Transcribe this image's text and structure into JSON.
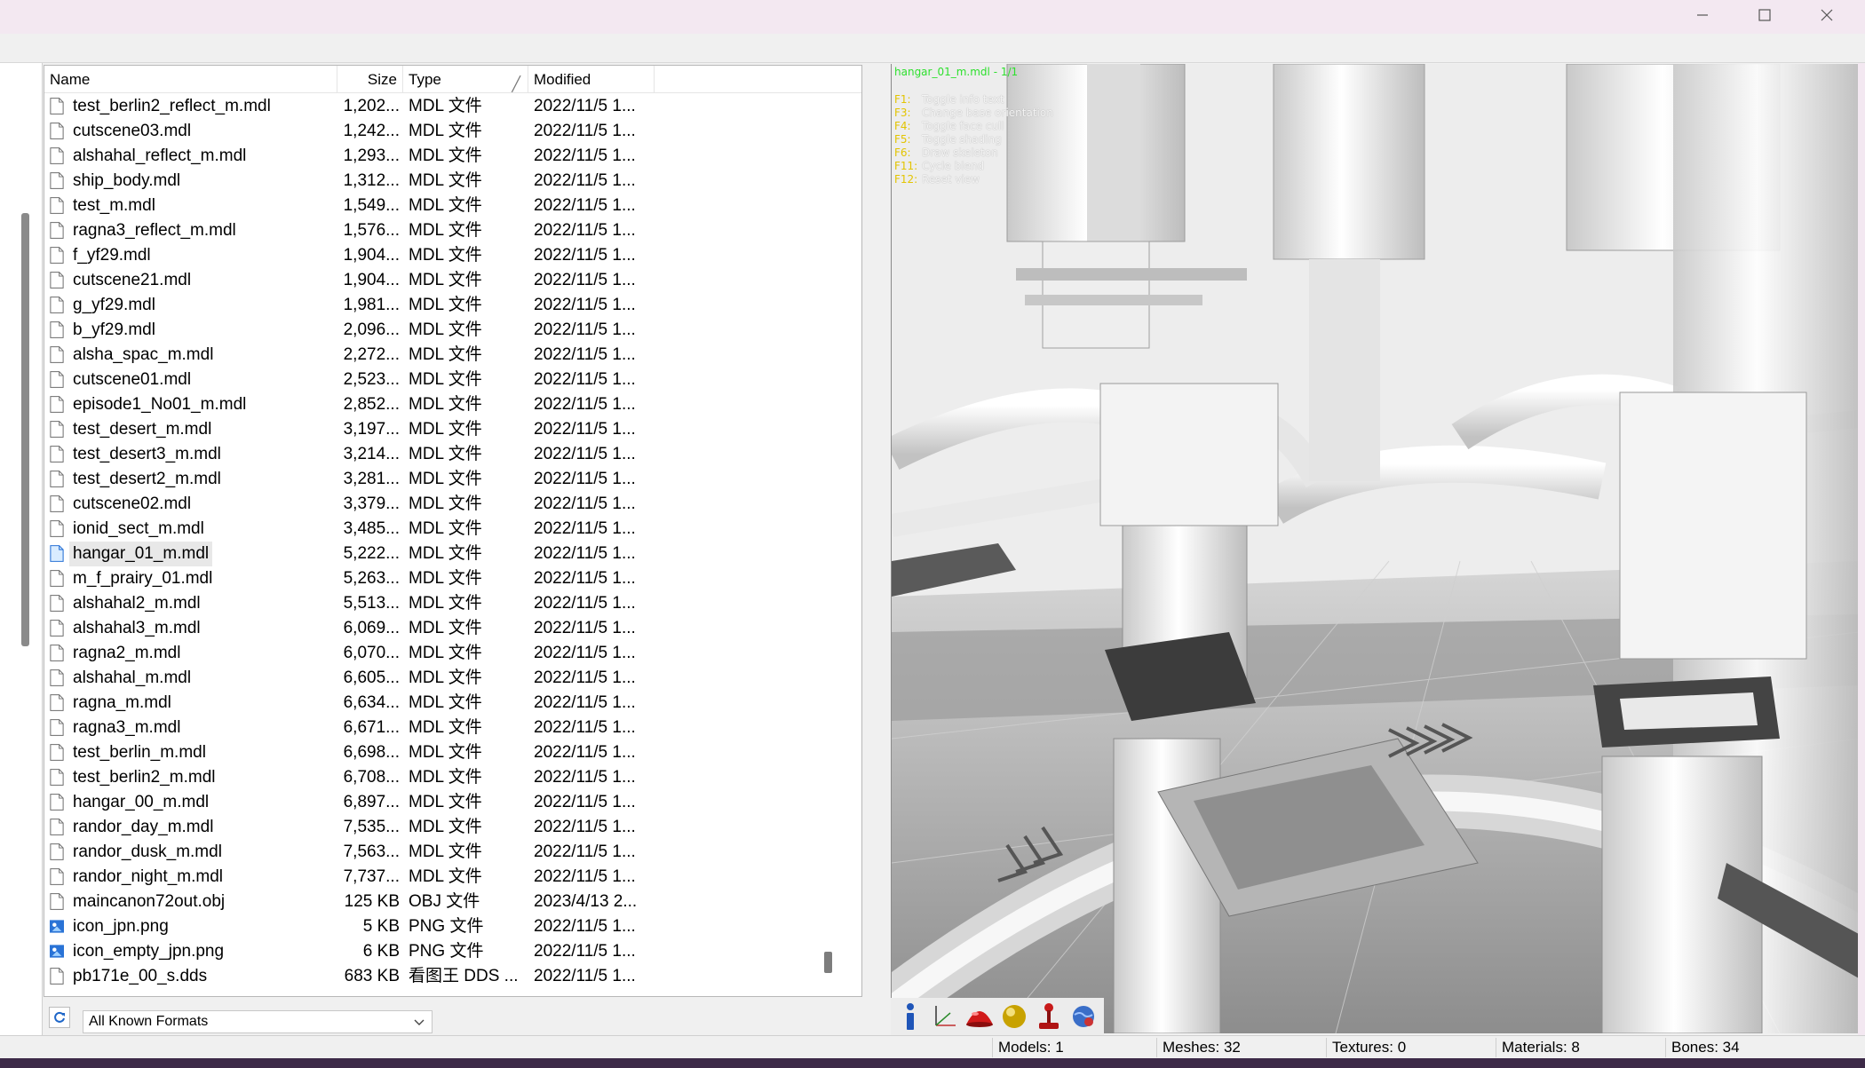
{
  "window": {
    "controls": [
      "minimize-icon",
      "maximize-icon",
      "close-icon"
    ]
  },
  "file_list": {
    "columns": {
      "name": "Name",
      "size": "Size",
      "type": "Type",
      "modified": "Modified"
    },
    "selected_index": 18,
    "files": [
      {
        "name": "test_berlin2_reflect_m.mdl",
        "size": "1,202...",
        "type": "MDL 文件",
        "modified": "2022/11/5 1...",
        "icon": "file-icon"
      },
      {
        "name": "cutscene03.mdl",
        "size": "1,242...",
        "type": "MDL 文件",
        "modified": "2022/11/5 1...",
        "icon": "file-icon"
      },
      {
        "name": "alshahal_reflect_m.mdl",
        "size": "1,293...",
        "type": "MDL 文件",
        "modified": "2022/11/5 1...",
        "icon": "file-icon"
      },
      {
        "name": "ship_body.mdl",
        "size": "1,312...",
        "type": "MDL 文件",
        "modified": "2022/11/5 1...",
        "icon": "file-icon"
      },
      {
        "name": "test_m.mdl",
        "size": "1,549...",
        "type": "MDL 文件",
        "modified": "2022/11/5 1...",
        "icon": "file-icon"
      },
      {
        "name": "ragna3_reflect_m.mdl",
        "size": "1,576...",
        "type": "MDL 文件",
        "modified": "2022/11/5 1...",
        "icon": "file-icon"
      },
      {
        "name": "f_yf29.mdl",
        "size": "1,904...",
        "type": "MDL 文件",
        "modified": "2022/11/5 1...",
        "icon": "file-icon"
      },
      {
        "name": "cutscene21.mdl",
        "size": "1,904...",
        "type": "MDL 文件",
        "modified": "2022/11/5 1...",
        "icon": "file-icon"
      },
      {
        "name": "g_yf29.mdl",
        "size": "1,981...",
        "type": "MDL 文件",
        "modified": "2022/11/5 1...",
        "icon": "file-icon"
      },
      {
        "name": "b_yf29.mdl",
        "size": "2,096...",
        "type": "MDL 文件",
        "modified": "2022/11/5 1...",
        "icon": "file-icon"
      },
      {
        "name": "alsha_spac_m.mdl",
        "size": "2,272...",
        "type": "MDL 文件",
        "modified": "2022/11/5 1...",
        "icon": "file-icon"
      },
      {
        "name": "cutscene01.mdl",
        "size": "2,523...",
        "type": "MDL 文件",
        "modified": "2022/11/5 1...",
        "icon": "file-icon"
      },
      {
        "name": "episode1_No01_m.mdl",
        "size": "2,852...",
        "type": "MDL 文件",
        "modified": "2022/11/5 1...",
        "icon": "file-icon"
      },
      {
        "name": "test_desert_m.mdl",
        "size": "3,197...",
        "type": "MDL 文件",
        "modified": "2022/11/5 1...",
        "icon": "file-icon"
      },
      {
        "name": "test_desert3_m.mdl",
        "size": "3,214...",
        "type": "MDL 文件",
        "modified": "2022/11/5 1...",
        "icon": "file-icon"
      },
      {
        "name": "test_desert2_m.mdl",
        "size": "3,281...",
        "type": "MDL 文件",
        "modified": "2022/11/5 1...",
        "icon": "file-icon"
      },
      {
        "name": "cutscene02.mdl",
        "size": "3,379...",
        "type": "MDL 文件",
        "modified": "2022/11/5 1...",
        "icon": "file-icon"
      },
      {
        "name": "ionid_sect_m.mdl",
        "size": "3,485...",
        "type": "MDL 文件",
        "modified": "2022/11/5 1...",
        "icon": "file-icon"
      },
      {
        "name": "hangar_01_m.mdl",
        "size": "5,222...",
        "type": "MDL 文件",
        "modified": "2022/11/5 1...",
        "icon": "file-selected-icon"
      },
      {
        "name": "m_f_prairy_01.mdl",
        "size": "5,263...",
        "type": "MDL 文件",
        "modified": "2022/11/5 1...",
        "icon": "file-icon"
      },
      {
        "name": "alshahal2_m.mdl",
        "size": "5,513...",
        "type": "MDL 文件",
        "modified": "2022/11/5 1...",
        "icon": "file-icon"
      },
      {
        "name": "alshahal3_m.mdl",
        "size": "6,069...",
        "type": "MDL 文件",
        "modified": "2022/11/5 1...",
        "icon": "file-icon"
      },
      {
        "name": "ragna2_m.mdl",
        "size": "6,070...",
        "type": "MDL 文件",
        "modified": "2022/11/5 1...",
        "icon": "file-icon"
      },
      {
        "name": "alshahal_m.mdl",
        "size": "6,605...",
        "type": "MDL 文件",
        "modified": "2022/11/5 1...",
        "icon": "file-icon"
      },
      {
        "name": "ragna_m.mdl",
        "size": "6,634...",
        "type": "MDL 文件",
        "modified": "2022/11/5 1...",
        "icon": "file-icon"
      },
      {
        "name": "ragna3_m.mdl",
        "size": "6,671...",
        "type": "MDL 文件",
        "modified": "2022/11/5 1...",
        "icon": "file-icon"
      },
      {
        "name": "test_berlin_m.mdl",
        "size": "6,698...",
        "type": "MDL 文件",
        "modified": "2022/11/5 1...",
        "icon": "file-icon"
      },
      {
        "name": "test_berlin2_m.mdl",
        "size": "6,708...",
        "type": "MDL 文件",
        "modified": "2022/11/5 1...",
        "icon": "file-icon"
      },
      {
        "name": "hangar_00_m.mdl",
        "size": "6,897...",
        "type": "MDL 文件",
        "modified": "2022/11/5 1...",
        "icon": "file-icon"
      },
      {
        "name": "randor_day_m.mdl",
        "size": "7,535...",
        "type": "MDL 文件",
        "modified": "2022/11/5 1...",
        "icon": "file-icon"
      },
      {
        "name": "randor_dusk_m.mdl",
        "size": "7,563...",
        "type": "MDL 文件",
        "modified": "2022/11/5 1...",
        "icon": "file-icon"
      },
      {
        "name": "randor_night_m.mdl",
        "size": "7,737...",
        "type": "MDL 文件",
        "modified": "2022/11/5 1...",
        "icon": "file-icon"
      },
      {
        "name": "maincanon72out.obj",
        "size": "125 KB",
        "type": "OBJ 文件",
        "modified": "2023/4/13 2...",
        "icon": "file-icon"
      },
      {
        "name": "icon_jpn.png",
        "size": "5 KB",
        "type": "PNG 文件",
        "modified": "2022/11/5 1...",
        "icon": "image-file-icon"
      },
      {
        "name": "icon_empty_jpn.png",
        "size": "6 KB",
        "type": "PNG 文件",
        "modified": "2022/11/5 1...",
        "icon": "image-file-icon"
      },
      {
        "name": "pb171e_00_s.dds",
        "size": "683 KB",
        "type": "看图王 DDS ...",
        "modified": "2022/11/5 1...",
        "icon": "file-icon"
      }
    ]
  },
  "filter": {
    "selected": "All Known Formats"
  },
  "viewport": {
    "title": "hangar_01_m.mdl - 1/1",
    "help": [
      {
        "key": "F1:",
        "desc": "Toggle info text"
      },
      {
        "key": "F3:",
        "desc": "Change base orientation"
      },
      {
        "key": "F4:",
        "desc": "Toggle face cull"
      },
      {
        "key": "F5:",
        "desc": "Toggle shading"
      },
      {
        "key": "F6:",
        "desc": "Draw skeleton"
      },
      {
        "key": "F11:",
        "desc": "Cycle blend"
      },
      {
        "key": "F12:",
        "desc": "Reset view"
      }
    ]
  },
  "toolbar": {
    "tools": [
      "info-icon",
      "axes-icon",
      "red-dome-icon",
      "gold-sphere-icon",
      "joystick-icon",
      "globe-icon"
    ]
  },
  "status": {
    "models": "Models: 1",
    "meshes": "Meshes: 32",
    "textures": "Textures: 0",
    "materials": "Materials: 8",
    "bones": "Bones: 34"
  },
  "colors": {
    "accent_green": "#2ee02e",
    "hotkey_yellow": "#e3c400",
    "selection": "#e8e8e8",
    "bottom_edge": "#3d2a48"
  }
}
